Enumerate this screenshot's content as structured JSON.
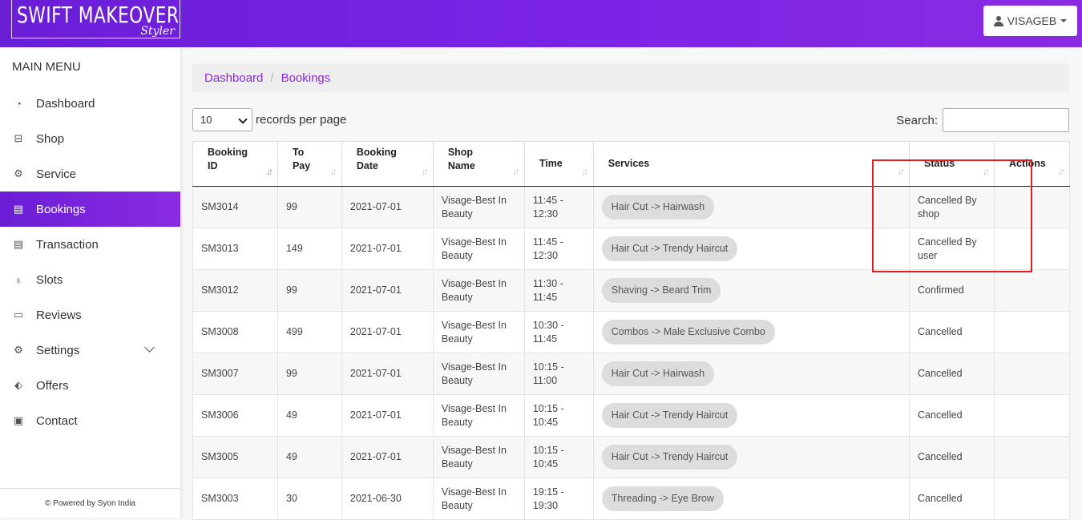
{
  "brand": {
    "name": "SWIFT MAKEOVER",
    "tagline": "Styler"
  },
  "user": {
    "label": "VISAGEB"
  },
  "sidebar": {
    "title": "MAIN MENU",
    "items": [
      {
        "label": "Dashboard",
        "icon": "dashboard-icon"
      },
      {
        "label": "Shop",
        "icon": "briefcase-icon"
      },
      {
        "label": "Service",
        "icon": "gears-icon"
      },
      {
        "label": "Bookings",
        "icon": "book-icon",
        "active": true
      },
      {
        "label": "Transaction",
        "icon": "ledger-icon"
      },
      {
        "label": "Slots",
        "icon": "slot-icon"
      },
      {
        "label": "Reviews",
        "icon": "comment-icon"
      },
      {
        "label": "Settings",
        "icon": "gear-icon",
        "has_submenu": true
      },
      {
        "label": "Offers",
        "icon": "tag-icon"
      },
      {
        "label": "Contact",
        "icon": "contact-icon"
      }
    ],
    "footer": "© Powered by Syon India"
  },
  "breadcrumb": {
    "items": [
      "Dashboard",
      "Bookings"
    ]
  },
  "table_controls": {
    "page_length_value": "10",
    "page_length_label": "records per page",
    "search_label": "Search:",
    "search_value": ""
  },
  "table": {
    "columns": [
      "Booking ID",
      "To Pay",
      "Booking Date",
      "Shop Name",
      "Time",
      "Services",
      "Status",
      "Actions"
    ],
    "rows": [
      {
        "id": "SM3014",
        "pay": "99",
        "date": "2021-07-01",
        "shop": "Visage-Best In Beauty",
        "time": "11:45 - 12:30",
        "service": "Hair Cut -> Hairwash",
        "status": "Cancelled By shop"
      },
      {
        "id": "SM3013",
        "pay": "149",
        "date": "2021-07-01",
        "shop": "Visage-Best In Beauty",
        "time": "11:45 - 12:30",
        "service": "Hair Cut -> Trendy Haircut",
        "status": "Cancelled By user"
      },
      {
        "id": "SM3012",
        "pay": "99",
        "date": "2021-07-01",
        "shop": "Visage-Best In Beauty",
        "time": "11:30 - 11:45",
        "service": "Shaving -> Beard Trim",
        "status": "Confirmed"
      },
      {
        "id": "SM3008",
        "pay": "499",
        "date": "2021-07-01",
        "shop": "Visage-Best In Beauty",
        "time": "10:30 - 11:45",
        "service": "Combos -> Male Exclusive Combo",
        "status": "Cancelled"
      },
      {
        "id": "SM3007",
        "pay": "99",
        "date": "2021-07-01",
        "shop": "Visage-Best In Beauty",
        "time": "10:15 - 11:00",
        "service": "Hair Cut -> Hairwash",
        "status": "Cancelled"
      },
      {
        "id": "SM3006",
        "pay": "49",
        "date": "2021-07-01",
        "shop": "Visage-Best In Beauty",
        "time": "10:15 - 10:45",
        "service": "Hair Cut -> Trendy Haircut",
        "status": "Cancelled"
      },
      {
        "id": "SM3005",
        "pay": "49",
        "date": "2021-07-01",
        "shop": "Visage-Best In Beauty",
        "time": "10:15 - 10:45",
        "service": "Hair Cut -> Trendy Haircut",
        "status": "Cancelled"
      },
      {
        "id": "SM3003",
        "pay": "30",
        "date": "2021-06-30",
        "shop": "Visage-Best In Beauty",
        "time": "19:15 - 19:30",
        "service": "Threading -> Eye Brow",
        "status": "Cancelled"
      }
    ]
  },
  "colors": {
    "brand_purple": "#7a24e6",
    "highlight_red": "#e02020",
    "link": "#8a2be2"
  }
}
